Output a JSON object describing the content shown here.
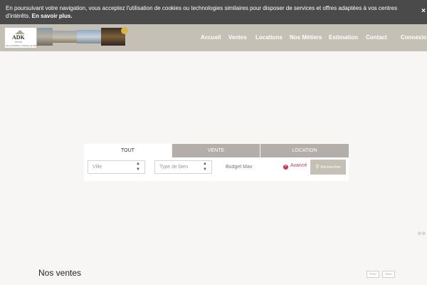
{
  "cookie": {
    "text": "En poursuivant votre navigation, vous acceptez l'utilisation de cookies ou technologies similaires pour disposer de services et offres adaptées à vos centres d'intérêts.",
    "more_label": "En savoir plus.",
    "close_label": "×"
  },
  "logo": {
    "name": "ADK",
    "sub": "Immo",
    "tag": "des possibilités, l'habitat par ADK"
  },
  "nav": {
    "items": [
      "Accueil",
      "Ventes",
      "Locations",
      "Nos Métiers",
      "Estimation",
      "Contact",
      "Connexion"
    ]
  },
  "search": {
    "tabs": [
      "TOUT",
      "VENTE",
      "LOCATION"
    ],
    "city_placeholder": "Ville",
    "type_placeholder": "Type de bien",
    "budget_placeholder": "Budget Max",
    "advanced_label": "Avancé",
    "submit_label": "Rechercher"
  },
  "sales": {
    "title": "Nos ventes",
    "prev_label": "Prev",
    "next_label": "Next"
  },
  "colors": {
    "header": "#c5c0b5",
    "cookie_bar": "#4a4a4a",
    "accent": "#c33a4c",
    "tab_inactive": "#b3aeaa"
  }
}
